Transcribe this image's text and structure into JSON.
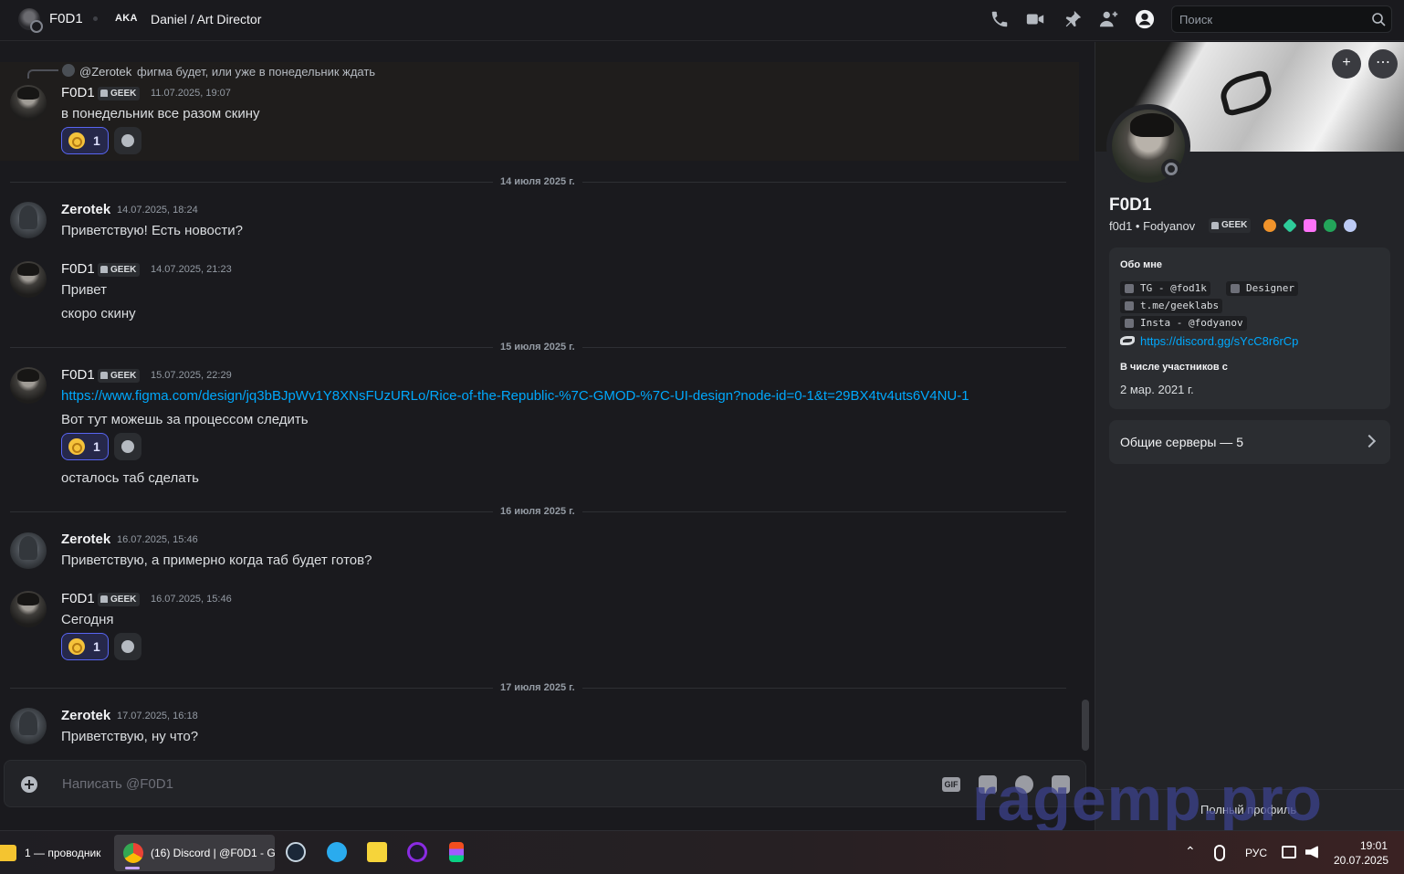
{
  "header": {
    "name": "F0D1",
    "aka": "AKA",
    "nickname": "Daniel / Art Director",
    "icons": [
      "phone-call-icon",
      "video-call-icon",
      "pin-icon",
      "add-friends-icon",
      "user-profile-icon"
    ],
    "search_placeholder": "Поиск"
  },
  "messages": {
    "reply": {
      "name": "@Zerotek",
      "text": "фигма будет, или уже в понедельник ждать"
    },
    "m1": {
      "author": "F0D1",
      "tag": "GEEK",
      "time": "11.07.2025, 19:07",
      "text": "в понедельник все разом скину",
      "reaction_count": "1"
    },
    "d1": "14 июля 2025 г.",
    "m2": {
      "author": "Zerotek",
      "time": "14.07.2025, 18:24",
      "text": "Приветствую! Есть новости?"
    },
    "m3": {
      "author": "F0D1",
      "tag": "GEEK",
      "time": "14.07.2025, 21:23",
      "line1": "Привет",
      "line2": "скоро скину"
    },
    "d2": "15 июля 2025 г.",
    "m4": {
      "author": "F0D1",
      "tag": "GEEK",
      "time": "15.07.2025, 22:29",
      "link": "https://www.figma.com/design/jq3bBJpWv1Y8XNsFUzURLo/Rice-of-the-Republic-%7C-GMOD-%7C-UI-design?node-id=0-1&t=29BX4tv4uts6V4NU-1",
      "text": "Вот тут можешь за процессом следить",
      "reaction_count": "1",
      "text2": "осталось таб сделать"
    },
    "d3": "16 июля 2025 г.",
    "m5": {
      "author": "Zerotek",
      "time": "16.07.2025, 15:46",
      "text": "Приветствую, а примерно когда таб будет готов?"
    },
    "m6": {
      "author": "F0D1",
      "tag": "GEEK",
      "time": "16.07.2025, 15:46",
      "text": "Сегодня",
      "reaction_count": "1"
    },
    "d4": "17 июля 2025 г.",
    "m7": {
      "author": "Zerotek",
      "time": "17.07.2025, 16:18",
      "text": "Приветствую, ну что?"
    }
  },
  "composer": {
    "placeholder": "Написать @F0D1",
    "gif": "GIF"
  },
  "profile": {
    "name": "F0D1",
    "subtitle": "f0d1 • Fodyanov",
    "tag": "GEEK",
    "about_title": "Обо мне",
    "about": {
      "tg": "TG - @fod1k",
      "designer": "Designer",
      "tme": "t.me/geeklabs",
      "insta": "Insta - @fodyanov",
      "discord": "https://discord.gg/sYcC8r6rCp"
    },
    "member_title": "В числе участников с",
    "member_since": "2 мар. 2021 г.",
    "servers": "Общие серверы — 5",
    "full_profile": "Полный профиль"
  },
  "watermark": "ragemp.pro",
  "taskbar": {
    "explorer": "1 — проводник",
    "discord": "(16) Discord | @F0D1 - G",
    "lang": "РУС",
    "time": "19:01",
    "date": "20.07.2025"
  }
}
